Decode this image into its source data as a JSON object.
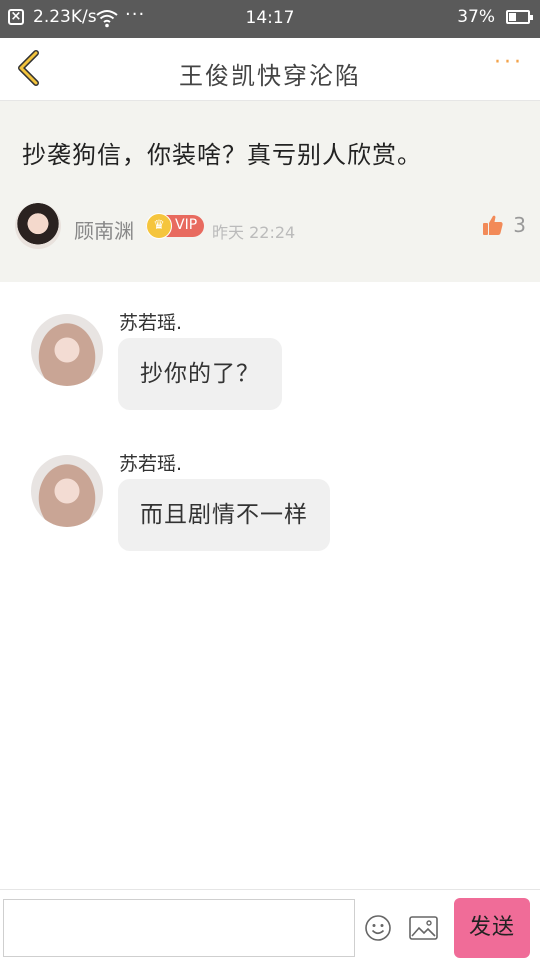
{
  "status_bar": {
    "speed": "2.23K/s",
    "time": "14:17",
    "battery": "37%",
    "icons": [
      "close-icon",
      "wifi-icon",
      "more-dots-icon",
      "battery-icon"
    ]
  },
  "header": {
    "title": "王俊凯快穿沦陷",
    "back_icon": "chevron-left-icon",
    "more_icon": "more-horizontal-icon",
    "more_label": "···",
    "accent_color": "#f3a34a"
  },
  "topic": {
    "text": "抄袭狗信，你装啥？真亏别人欣赏。",
    "author": {
      "name": "顾南渊",
      "vip_label": "VIP",
      "crown_glyph": "♛",
      "time": "昨天 22:24"
    },
    "likes": "3",
    "like_icon": "thumbs-up-icon",
    "like_color": "#f28a58"
  },
  "messages": [
    {
      "name": "苏若瑶.",
      "text": "抄你的了？"
    },
    {
      "name": "苏若瑶.",
      "text": "而且剧情不一样"
    }
  ],
  "input_bar": {
    "placeholder": "",
    "emoji_icon": "smiley-icon",
    "image_icon": "image-icon",
    "send_label": "发送",
    "send_color": "#f06c98"
  }
}
